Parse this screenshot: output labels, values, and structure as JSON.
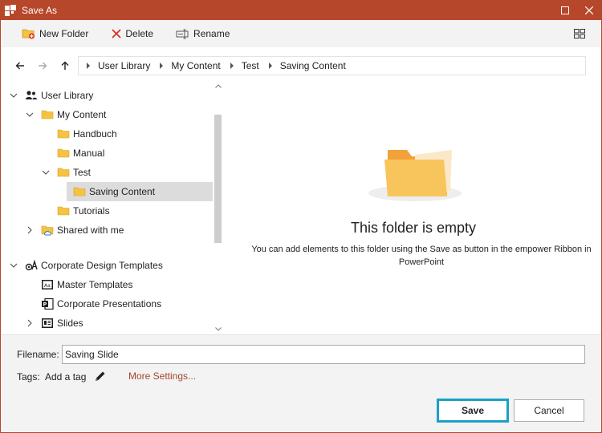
{
  "window": {
    "title": "Save As",
    "colors": {
      "titlebar": "#b7472a",
      "accent_link": "#a3472c",
      "focus_ring": "#1ba0c8",
      "folder": "#f5c242"
    }
  },
  "toolbar": {
    "new_folder": "New Folder",
    "delete": "Delete",
    "rename": "Rename"
  },
  "breadcrumb": [
    "User Library",
    "My Content",
    "Test",
    "Saving Content"
  ],
  "tree": {
    "user_library": "User Library",
    "my_content": "My Content",
    "handbuch": "Handbuch",
    "manual": "Manual",
    "test": "Test",
    "saving_content": "Saving Content",
    "tutorials": "Tutorials",
    "shared_with_me": "Shared with me",
    "corporate_design_templates": "Corporate Design Templates",
    "master_templates": "Master Templates",
    "corporate_presentations": "Corporate Presentations",
    "slides": "Slides"
  },
  "main": {
    "empty_title": "This folder is empty",
    "empty_desc": "You can add elements to this folder using the Save as button in the empower Ribbon in PowerPoint"
  },
  "footer": {
    "filename_label": "Filename:",
    "filename_value": "Saving Slide",
    "tags_label": "Tags:",
    "add_tag": "Add a tag",
    "more_settings": "More Settings...",
    "save": "Save",
    "cancel": "Cancel"
  }
}
